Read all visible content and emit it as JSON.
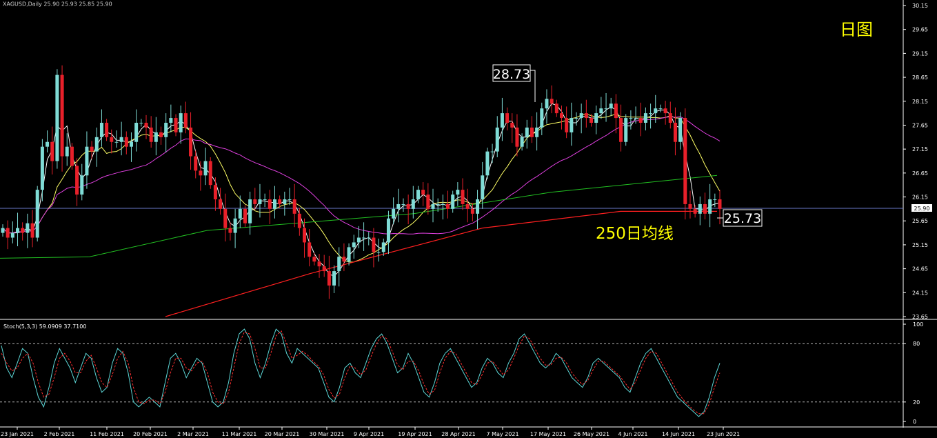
{
  "header": {
    "symbol_line": "XAGUSD,Daily  25.90 25.93 25.85 25.90",
    "period_label": "日图"
  },
  "annotations": {
    "high_label": "28.73",
    "low_label": "25.73",
    "ma_label": "250日均线",
    "current_price": "25.90"
  },
  "colors": {
    "background": "#000000",
    "bull_candle": "#7fdcd6",
    "bear_candle": "#e8202a",
    "ma_fast": "#ffffff",
    "ma_20": "#ffff66",
    "ma_60": "#e040e0",
    "ma_120": "#22c022",
    "ma_250": "#ff2020",
    "stoch_main": "#5cd6d6",
    "stoch_signal": "#ff3030",
    "label_yellow": "#ffff00"
  },
  "chart_data": [
    {
      "type": "candlestick",
      "title": "",
      "ylim": [
        23.65,
        30.15
      ],
      "y_ticks": [
        "30.15",
        "29.65",
        "29.15",
        "28.65",
        "28.15",
        "27.65",
        "27.15",
        "26.65",
        "26.15",
        "25.65",
        "25.15",
        "24.65",
        "24.15",
        "23.65"
      ],
      "x_ticks": [
        "23 Jan 2021",
        "2 Feb 2021",
        "11 Feb 2021",
        "20 Feb 2021",
        "2 Mar 2021",
        "11 Mar 2021",
        "20 Mar 2021",
        "30 Mar 2021",
        "9 Apr 2021",
        "19 Apr 2021",
        "28 Apr 2021",
        "7 May 2021",
        "17 May 2021",
        "26 May 2021",
        "4 Jun 2021",
        "14 Jun 2021",
        "23 Jun 2021"
      ],
      "series": [
        {
          "name": "price",
          "close": [
            25.5,
            25.3,
            25.4,
            25.5,
            25.4,
            25.6,
            25.3,
            26.3,
            27.2,
            27.3,
            26.9,
            28.7,
            27.0,
            27.2,
            26.8,
            26.2,
            26.6,
            27.2,
            27.1,
            27.4,
            27.7,
            27.4,
            27.3,
            27.3,
            27.4,
            27.2,
            27.3,
            27.7,
            27.7,
            27.6,
            27.3,
            27.5,
            27.4,
            27.7,
            27.8,
            27.5,
            27.9,
            27.6,
            27.0,
            26.7,
            26.6,
            26.9,
            26.4,
            26.1,
            25.9,
            25.5,
            25.4,
            25.7,
            25.9,
            25.6,
            26.1,
            26.0,
            26.1,
            26.1,
            25.9,
            26.1,
            26.0,
            26.1,
            26.1,
            25.8,
            25.5,
            25.2,
            24.9,
            24.8,
            24.7,
            24.6,
            24.3,
            24.6,
            24.9,
            24.8,
            25.1,
            25.2,
            25.3,
            25.3,
            25.3,
            25.0,
            25.0,
            25.2,
            25.7,
            25.9,
            26.0,
            26.0,
            25.9,
            26.1,
            26.3,
            26.2,
            25.9,
            26.0,
            26.0,
            26.0,
            25.9,
            26.2,
            26.3,
            26.0,
            25.9,
            25.8,
            26.1,
            26.6,
            27.1,
            27.1,
            27.6,
            27.9,
            27.7,
            27.6,
            27.2,
            27.4,
            27.6,
            27.4,
            27.6,
            28.0,
            28.2,
            28.1,
            27.9,
            27.8,
            27.5,
            27.8,
            27.8,
            27.9,
            27.8,
            27.7,
            27.9,
            28.0,
            28.0,
            28.1,
            27.8,
            27.3,
            27.8,
            27.8,
            27.8,
            27.7,
            27.9,
            27.9,
            28.0,
            28.0,
            27.9,
            27.7,
            27.3,
            27.8,
            26.0,
            25.9,
            25.8,
            26.0,
            25.8,
            26.1,
            26.1,
            25.9
          ]
        },
        {
          "name": "MA",
          "period_color": "white"
        },
        {
          "name": "MA",
          "period_color": "yellow"
        },
        {
          "name": "MA",
          "period_color": "magenta"
        },
        {
          "name": "MA",
          "period_color": "green"
        },
        {
          "name": "250日均线",
          "period_color": "red"
        }
      ]
    },
    {
      "type": "line",
      "title": "Stoch(5,3,3) 59.0909 37.7100",
      "ylim": [
        0,
        100
      ],
      "y_ticks": [
        "100",
        "80",
        "20",
        "0"
      ],
      "levels": [
        80,
        20
      ],
      "series": [
        {
          "name": "main",
          "values": [
            78,
            55,
            45,
            60,
            75,
            70,
            45,
            25,
            15,
            35,
            60,
            75,
            65,
            55,
            40,
            55,
            70,
            65,
            45,
            30,
            35,
            60,
            75,
            70,
            50,
            20,
            15,
            20,
            25,
            20,
            15,
            40,
            65,
            70,
            60,
            45,
            55,
            65,
            60,
            40,
            20,
            15,
            20,
            40,
            70,
            90,
            95,
            85,
            60,
            45,
            60,
            80,
            95,
            90,
            70,
            60,
            75,
            70,
            65,
            60,
            55,
            40,
            25,
            20,
            35,
            55,
            60,
            50,
            45,
            60,
            75,
            85,
            90,
            80,
            65,
            50,
            55,
            70,
            60,
            45,
            30,
            25,
            40,
            60,
            70,
            75,
            65,
            55,
            45,
            35,
            40,
            55,
            65,
            60,
            50,
            45,
            60,
            70,
            85,
            90,
            80,
            70,
            60,
            55,
            60,
            70,
            65,
            55,
            45,
            40,
            35,
            45,
            60,
            65,
            60,
            55,
            50,
            45,
            35,
            30,
            45,
            60,
            70,
            75,
            65,
            55,
            45,
            35,
            25,
            20,
            15,
            10,
            5,
            10,
            25,
            45,
            60
          ]
        },
        {
          "name": "signal",
          "values": [
            70,
            60,
            52,
            55,
            65,
            70,
            60,
            40,
            25,
            28,
            45,
            65,
            70,
            62,
            50,
            50,
            62,
            68,
            55,
            40,
            35,
            48,
            65,
            72,
            60,
            35,
            20,
            18,
            22,
            22,
            18,
            30,
            50,
            65,
            65,
            55,
            52,
            60,
            62,
            50,
            30,
            20,
            18,
            30,
            55,
            80,
            92,
            90,
            75,
            55,
            55,
            70,
            88,
            93,
            80,
            65,
            68,
            72,
            68,
            62,
            57,
            48,
            33,
            24,
            28,
            45,
            57,
            55,
            48,
            53,
            67,
            80,
            88,
            85,
            72,
            58,
            53,
            62,
            62,
            52,
            38,
            28,
            32,
            50,
            65,
            72,
            70,
            60,
            50,
            40,
            38,
            48,
            60,
            62,
            55,
            48,
            53,
            65,
            78,
            88,
            85,
            75,
            65,
            58,
            58,
            65,
            66,
            60,
            50,
            43,
            38,
            42,
            53,
            62,
            62,
            57,
            52,
            47,
            40,
            33,
            40,
            53,
            65,
            72,
            70,
            60,
            50,
            40,
            30,
            23,
            17,
            12,
            8,
            8,
            18,
            35,
            50
          ]
        }
      ]
    }
  ]
}
